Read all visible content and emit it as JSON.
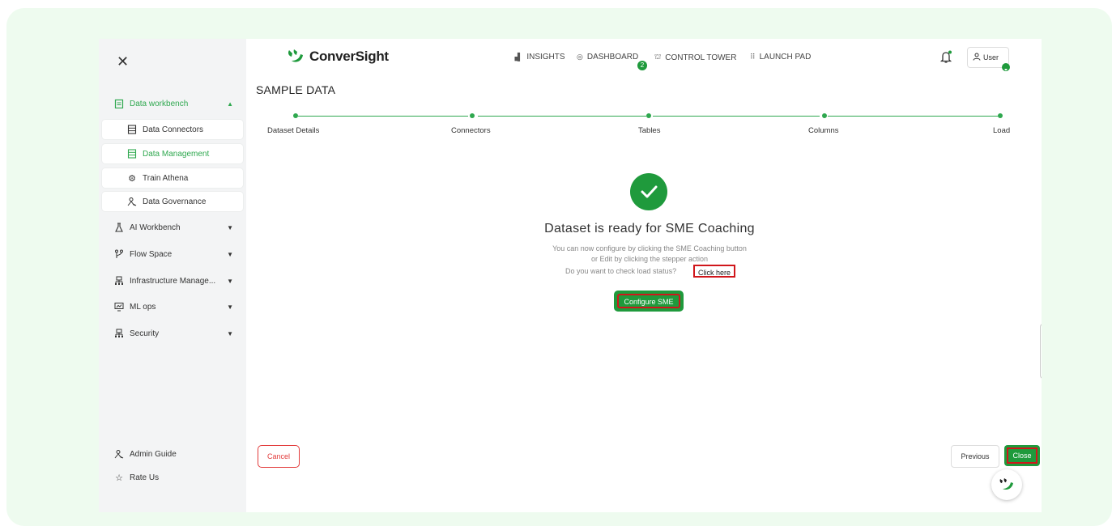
{
  "app": {
    "brand": "ConverSight"
  },
  "sidebar": {
    "close_icon": "close-icon",
    "data_workbench": {
      "label": "Data workbench",
      "icon": "clipboard-icon",
      "expanded": true
    },
    "sub_items": [
      {
        "label": "Data Connectors",
        "icon": "database-icon"
      },
      {
        "label": "Data Management",
        "icon": "database-icon",
        "active": true
      },
      {
        "label": "Train Athena",
        "icon": "gear-icon"
      },
      {
        "label": "Data Governance",
        "icon": "people-icon"
      }
    ],
    "items": [
      {
        "label": "AI Workbench",
        "icon": "flask-icon"
      },
      {
        "label": "Flow Space",
        "icon": "branch-icon"
      },
      {
        "label": "Infrastructure Manage...",
        "icon": "network-icon"
      },
      {
        "label": "ML ops",
        "icon": "monitor-icon"
      },
      {
        "label": "Security",
        "icon": "network-icon"
      }
    ],
    "footer": [
      {
        "label": "Admin Guide",
        "icon": "people-icon"
      },
      {
        "label": "Rate Us",
        "icon": "star-icon"
      }
    ]
  },
  "topnav": {
    "insights": "INSIGHTS",
    "dashboard": "DASHBOARD",
    "dashboard_badge": "2",
    "control_tower": "CONTROL TOWER",
    "launch_pad": "LAUNCH PAD",
    "user": "User"
  },
  "page": {
    "title": "SAMPLE DATA"
  },
  "stepper": {
    "steps": [
      "Dataset Details",
      "Connectors",
      "Tables",
      "Columns",
      "Load"
    ]
  },
  "status": {
    "title": "Dataset is ready for SME Coaching",
    "line1": "You can now configure by clicking the SME Coaching button",
    "line2": "or Edit by clicking the stepper action",
    "line3": "Do you want to check load status?",
    "link": "Click here",
    "configure_button": "Configure SME"
  },
  "footer": {
    "cancel": "Cancel",
    "previous": "Previous",
    "close": "Close"
  },
  "colors": {
    "accent": "#1f9a3c",
    "highlight": "#d0161b",
    "cancel": "#e23b3b"
  }
}
